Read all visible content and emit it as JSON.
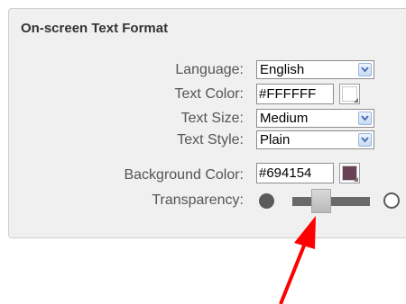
{
  "panel": {
    "title": "On-screen Text Format",
    "language": {
      "label": "Language:",
      "value": "English"
    },
    "text_color": {
      "label": "Text Color:",
      "value": "#FFFFFF",
      "swatch": "#FFFFFF"
    },
    "text_size": {
      "label": "Text Size:",
      "value": "Medium"
    },
    "text_style": {
      "label": "Text Style:",
      "value": "Plain"
    },
    "background_color": {
      "label": "Background Color:",
      "value": "#694154",
      "swatch": "#694154"
    },
    "transparency": {
      "label": "Transparency:",
      "level_percent": 30
    }
  },
  "annotation": {
    "arrow_color": "#ff0000",
    "icon": "red-pointer-arrow"
  },
  "colors": {
    "panel_bg": "#f0f0f0",
    "dropdown_chevron": "#4a6fb5"
  }
}
